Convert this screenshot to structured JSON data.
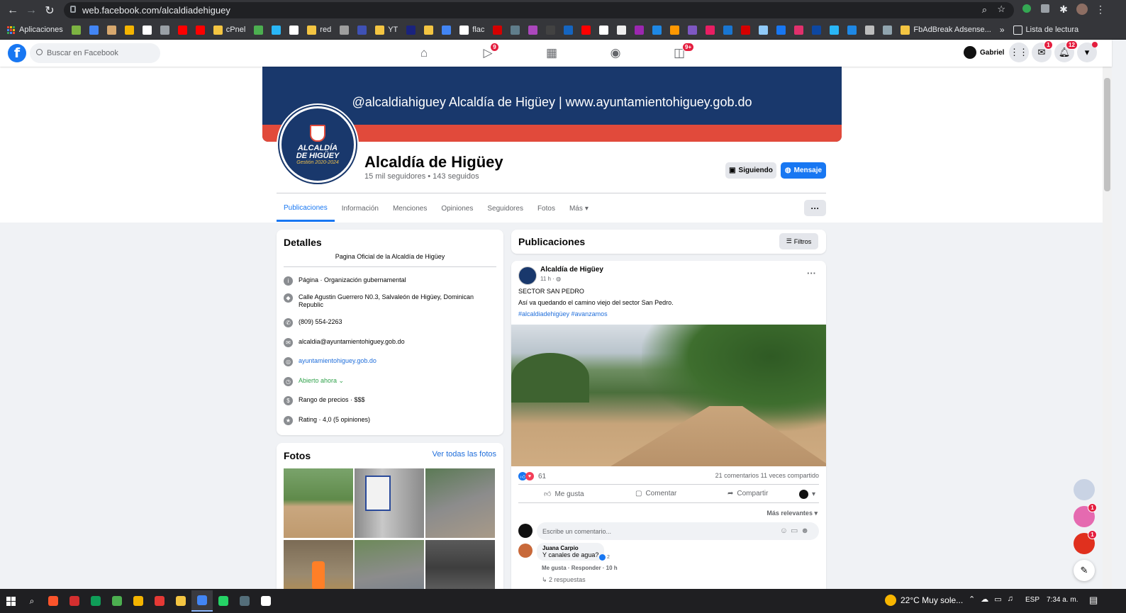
{
  "browser": {
    "url": "web.facebook.com/alcaldiadehiguey",
    "bookmarks_label": "Aplicaciones",
    "bookmarks": [
      {
        "label": "",
        "color": "#7cb342"
      },
      {
        "label": "",
        "color": "#4285f4"
      },
      {
        "label": "",
        "color": "#d7a86e"
      },
      {
        "label": "",
        "color": "#f4b400"
      },
      {
        "label": "",
        "color": "#ffffff"
      },
      {
        "label": "",
        "color": "#9aa0a6"
      },
      {
        "label": "",
        "color": "#ff0000"
      },
      {
        "label": "",
        "color": "#ff0000"
      },
      {
        "label": "cPnel",
        "color": "#f4c542"
      },
      {
        "label": "",
        "color": "#4caf50"
      },
      {
        "label": "",
        "color": "#29b6f6"
      },
      {
        "label": "",
        "color": "#ffffff"
      },
      {
        "label": "red",
        "color": "#f4c542"
      },
      {
        "label": "",
        "color": "#9e9e9e"
      },
      {
        "label": "",
        "color": "#3f51b5"
      },
      {
        "label": "YT",
        "color": "#f4c542"
      },
      {
        "label": "",
        "color": "#1a237e"
      },
      {
        "label": "",
        "color": "#f4c542"
      },
      {
        "label": "",
        "color": "#4285f4"
      },
      {
        "label": "flac",
        "color": "#ffffff"
      },
      {
        "label": "",
        "color": "#d50000"
      },
      {
        "label": "",
        "color": "#607d8b"
      },
      {
        "label": "",
        "color": "#ab47bc"
      },
      {
        "label": "",
        "color": "#424242"
      }
    ],
    "bookmarks_more": [
      {
        "color": "#1565c0"
      },
      {
        "color": "#ff0000"
      },
      {
        "color": "#ffffff"
      },
      {
        "color": "#eeeeee"
      },
      {
        "color": "#9c27b0"
      },
      {
        "color": "#1e88e5"
      },
      {
        "color": "#ff9800"
      },
      {
        "color": "#7e57c2"
      },
      {
        "color": "#e91e63"
      },
      {
        "color": "#1976d2"
      },
      {
        "color": "#d50000"
      },
      {
        "color": "#90caf9"
      },
      {
        "color": "#1877f2"
      },
      {
        "color": "#e1306c"
      },
      {
        "color": "#0d47a1"
      },
      {
        "color": "#29b6f6"
      },
      {
        "color": "#1e88e5"
      },
      {
        "color": "#bdbdbd"
      },
      {
        "color": "#90a4ae"
      }
    ],
    "bookmark_last": "FbAdBreak Adsense...",
    "reading_list": "Lista de lectura"
  },
  "fb": {
    "search_placeholder": "Buscar en Facebook",
    "badges": {
      "watch": "9",
      "gaming": "9+",
      "messenger": "1",
      "notifications": "12"
    },
    "user": "Gabriel"
  },
  "page": {
    "cover_text": "@alcaldiahiguey  Alcaldía de Higüey  |  www.ayuntamientohiguey.gob.do",
    "avatar_line1": "ALCALDÍA",
    "avatar_line2": "DE HIGÜEY",
    "avatar_line3": "Gestión 2020-2024",
    "name": "Alcaldía de Higüey",
    "stats": "15 mil seguidores • 143 seguidos",
    "follow_btn": "Siguiendo",
    "message_btn": "Mensaje",
    "tabs": [
      "Publicaciones",
      "Información",
      "Menciones",
      "Opiniones",
      "Seguidores",
      "Fotos",
      "Más"
    ],
    "more_dots": "···"
  },
  "details": {
    "title": "Detalles",
    "subtitle": "Pagina Oficial de la Alcaldía de Higüey",
    "rows": [
      {
        "icon": "info-icon",
        "glyph": "i",
        "text": "Página · Organización gubernamental",
        "color": "#050505"
      },
      {
        "icon": "location-icon",
        "glyph": "◆",
        "text": "Calle Agustin Guerrero N0.3, Salvaleón de Higüey, Dominican Republic",
        "color": "#050505"
      },
      {
        "icon": "phone-icon",
        "glyph": "✆",
        "text": "(809) 554-2263",
        "color": "#050505"
      },
      {
        "icon": "email-icon",
        "glyph": "✉",
        "text": "alcaldia@ayuntamientohiguey.gob.do",
        "color": "#050505"
      },
      {
        "icon": "globe-icon",
        "glyph": "◎",
        "text": "ayuntamientohiguey.gob.do",
        "color": "#216fdb"
      },
      {
        "icon": "clock-icon",
        "glyph": "◷",
        "text": "Abierto ahora  ⌄",
        "color": "#31a24c"
      },
      {
        "icon": "price-icon",
        "glyph": "$",
        "text": "Rango de precios · $$$",
        "color": "#050505"
      },
      {
        "icon": "star-icon",
        "glyph": "★",
        "text": "Rating · 4,0 (5 opiniones)",
        "color": "#050505"
      }
    ]
  },
  "photos": {
    "title": "Fotos",
    "see_all": "Ver todas las fotos"
  },
  "feed": {
    "title": "Publicaciones",
    "filters": "Filtros",
    "post": {
      "author": "Alcaldía de Higüey",
      "time": "11 h · ",
      "line1": "SECTOR SAN PEDRO",
      "line2": "Así va quedando el camino viejo del sector San Pedro.",
      "hashtags": "#alcaldiadehigüey #avanzamos",
      "reactions": "61",
      "comments_shares": "21 comentarios  11 veces compartido",
      "like": "Me gusta",
      "comment": "Comentar",
      "share": "Compartir",
      "sort": "Más relevantes",
      "comment_placeholder": "Escribe un comentario...",
      "c_author": "Juana Carpio",
      "c_text": "Y canales de agua?",
      "c_likes": "2",
      "c_actions": "Me gusta · Responder · 10 h",
      "c_replies": "2 respuestas"
    }
  },
  "taskbar": {
    "weather": "22°C  Muy sole...",
    "lang": "ESP",
    "time": "7:34 a. m."
  },
  "chat_heads_badges": [
    "1",
    "1"
  ]
}
